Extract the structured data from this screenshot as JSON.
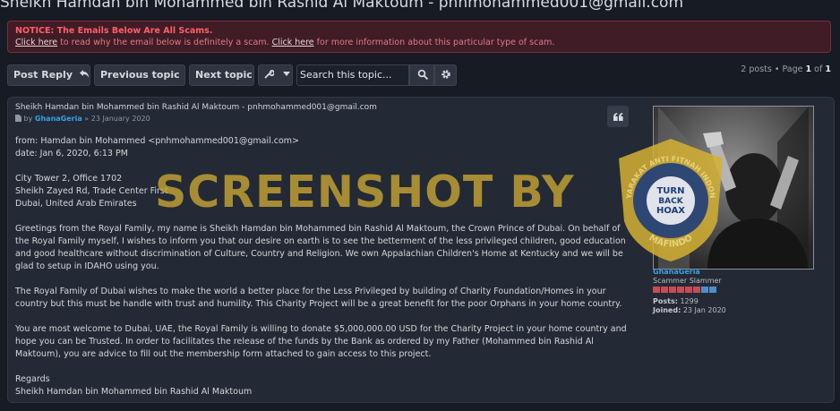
{
  "page_title": "Sheikh Hamdan bin Mohammed bin Rashid Al Maktoum - pnhmohammed001@gmail.com",
  "notice": {
    "title": "NOTICE: The Emails Below Are All Scams.",
    "link1": "Click here",
    "text1": " to read why the email below is definitely a scam. ",
    "link2": "Click here",
    "text2": " for more information about this particular type of scam."
  },
  "toolbar": {
    "post_reply": "Post Reply",
    "previous_topic": "Previous topic",
    "next_topic": "Next topic",
    "search_placeholder": "Search this topic..."
  },
  "pagination": {
    "posts": "2 posts",
    "page_word": "Page",
    "current": "1",
    "of_word": "of",
    "total": "1"
  },
  "post": {
    "title": "Sheikh Hamdan bin Mohammed bin Rashid Al Maktoum - pnhmohammed001@gmail.com",
    "by": "by",
    "author": "GhanaGeria",
    "date": "» 23 January 2020",
    "from": "from: Hamdan bin Mohammed <pnhmohammed001@gmail.com>",
    "date_line": "date: Jan 6, 2020, 6:13 PM",
    "addr1": "City Tower 2, Office 1702",
    "addr2": "Sheikh Zayed Rd, Trade Center First",
    "addr3": "Dubai, United Arab Emirates",
    "para1": "Greetings from the Royal Family, my name is Sheikh Hamdan bin Mohammed bin Rashid Al Maktoum, the Crown Prince of Dubai. On behalf of the Royal Family myself, I wishes to inform you that our desire on earth is to see the betterment of the less privileged children, good education and good healthcare without discrimination of Culture, Country and Religion. We own Appalachian Children's Home at Kentucky and we will be glad to setup in IDAHO using you.",
    "para2": "The Royal Family of Dubai wishes to make the world a better place for the Less Privileged by building of Charity Foundation/Homes in your country but this must be handle with trust and humility. This Charity Project will be a great benefit for the poor Orphans in your home country.",
    "para3": "You are most welcome to Dubai, UAE, the Royal Family is willing to donate $5,000,000.00 USD for the Charity Project in your home country and hope you can be Trusted. In order to facilitates the release of the funds by the Bank as ordered by my Father (Mohammed bin Rashid Al Maktoum), you are advice to fill out the membership form attached to gain access to this project.",
    "regards": "Regards",
    "signature": "Sheikh Hamdan bin Mohammed bin Rashid Al Maktoum"
  },
  "profile": {
    "name": "GhanaGeria",
    "rank": "Scammer Slammer",
    "posts_label": "Posts:",
    "posts_value": "1299",
    "joined_label": "Joined:",
    "joined_value": "23 Jan 2020",
    "rating_red": 6,
    "rating_total": 8
  },
  "watermark": {
    "text": "SCREENSHOT BY",
    "badge_ring": "MASYARAKAT ANTI FITNAH INDONESIA",
    "badge_line1": "TURN",
    "badge_line2": "BACK",
    "badge_line3": "HOAX",
    "badge_bottom": "MAFINDO"
  },
  "colors": {
    "accent": "#3ea0e6",
    "notice_bg": "#3f1c26",
    "notice_title": "#ff5f6a",
    "watermark": "#c8a534"
  }
}
